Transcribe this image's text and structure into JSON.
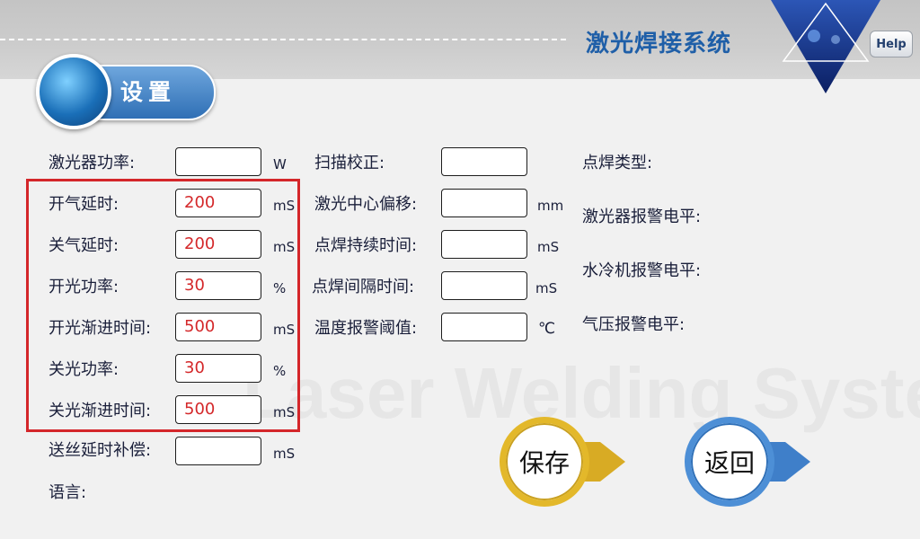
{
  "header": {
    "system_title": "激光焊接系统",
    "help_label": "Help"
  },
  "section": {
    "title": "设置"
  },
  "watermark": "Laser Welding System",
  "left_fields": [
    {
      "label": "激光器功率:",
      "value": "",
      "unit": "W"
    },
    {
      "label": "开气延时:",
      "value": "200",
      "unit": "mS"
    },
    {
      "label": "关气延时:",
      "value": "200",
      "unit": "mS"
    },
    {
      "label": "开光功率:",
      "value": "30",
      "unit": "%"
    },
    {
      "label": "开光渐进时间:",
      "value": "500",
      "unit": "mS"
    },
    {
      "label": "关光功率:",
      "value": "30",
      "unit": "%"
    },
    {
      "label": "关光渐进时间:",
      "value": "500",
      "unit": "mS"
    },
    {
      "label": "送丝延时补偿:",
      "value": "",
      "unit": "mS"
    },
    {
      "label": "语言:"
    }
  ],
  "middle_fields": [
    {
      "label": "扫描校正:",
      "value": "",
      "unit": ""
    },
    {
      "label": "激光中心偏移:",
      "value": "",
      "unit": "mm"
    },
    {
      "label": "点焊持续时间:",
      "value": "",
      "unit": "mS"
    },
    {
      "label": "点焊间隔时间:",
      "value": "",
      "unit": "mS"
    },
    {
      "label": "温度报警阈值:",
      "value": "",
      "unit": "℃"
    }
  ],
  "right_fields": [
    {
      "label": "点焊类型:"
    },
    {
      "label": "激光器报警电平:"
    },
    {
      "label": "水冷机报警电平:"
    },
    {
      "label": "气压报警电平:"
    }
  ],
  "buttons": {
    "save_label": "保存",
    "back_label": "返回"
  },
  "colors": {
    "title_blue": "#1f5fa8",
    "value_red": "#d4282a",
    "highlight_frame": "#d4262a",
    "save_ring": "#e3b82a",
    "back_ring": "#4d8fd6"
  }
}
